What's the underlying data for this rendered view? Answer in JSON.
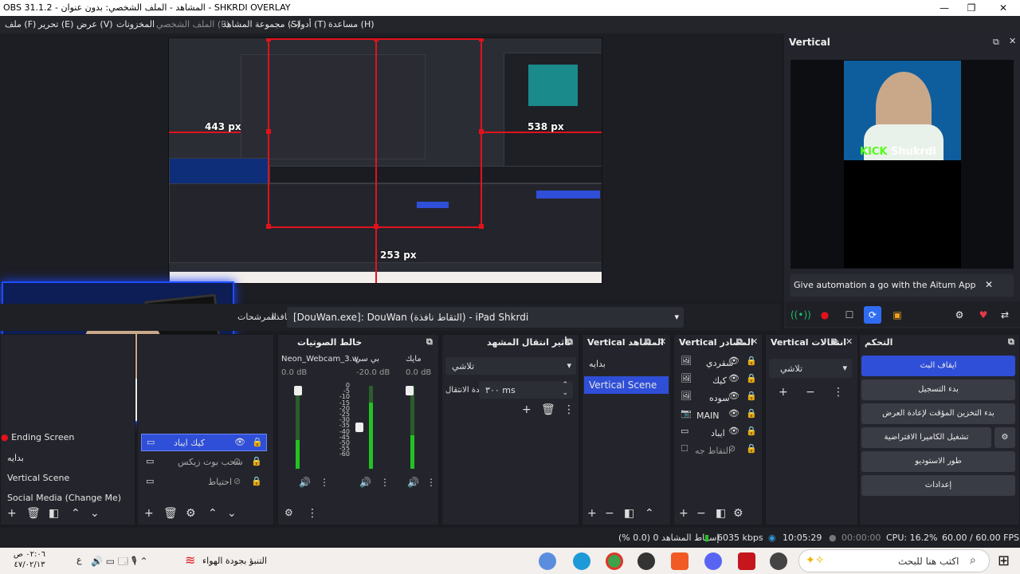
{
  "window": {
    "title": "OBS 31.1.2 - المشاهد - الملف الشخصي: بدون عنوان - SHKRDI OVERLAY"
  },
  "menu": [
    {
      "label": "ملف (F)"
    },
    {
      "label": "تحرير (E)"
    },
    {
      "label": "عرض (V)"
    },
    {
      "label": "المخزونات"
    },
    {
      "label": "الملف الشخصي (P)"
    },
    {
      "label": "مجموعة المشاهد (S)"
    },
    {
      "label": "أدوات (T)"
    },
    {
      "label": "مساعدة (H)"
    }
  ],
  "preview": {
    "label_left": "443 px",
    "label_right": "538 px",
    "label_bottom": "253 px"
  },
  "vertical_dock": {
    "title": "Vertical",
    "overlay_brand": "KICK",
    "overlay_name": "Shukrdi",
    "aitum_text": "Give automation a go with the Aitum App"
  },
  "source_toolbar": {
    "window_label": "نافذة",
    "window_value": "[DouWan.exe]: DouWan (التقاط نافذة) - iPad Shkrdi",
    "filters_label": "المرشحات"
  },
  "scenes": {
    "items": [
      "Ending Screen",
      "بدايه",
      "Vertical Scene",
      "Social Media (Change Me)"
    ]
  },
  "sources": {
    "items": [
      "كيك ايباد",
      "سحب بوت زيكس",
      "احتياط"
    ]
  },
  "mixer": {
    "title": "خالط الصوتيات",
    "channels": [
      {
        "name": "Neon_Webcam_3.w",
        "db": "0.0 dB",
        "level": 0.35
      },
      {
        "name": "بي سي",
        "db": "-20.0 dB",
        "level": 0.8
      },
      {
        "name": "مايك",
        "db": "0.0 dB",
        "level": 0.4
      }
    ],
    "scale": [
      "0",
      "-5",
      "-10",
      "-15",
      "-20",
      "-25",
      "-30",
      "-35",
      "-40",
      "-45",
      "-50",
      "-55",
      "-60"
    ]
  },
  "transitions": {
    "title": "تأثير انتقال المشهد",
    "type": "تلاشي",
    "duration_label": "مدة الانتقال",
    "duration_value": "٣٠٠ ms"
  },
  "vert_scenes": {
    "title": "Vertical المشاهد",
    "items": [
      "بدايه",
      "Vertical Scene"
    ]
  },
  "vert_sources": {
    "title": "Vertical المصادر",
    "items": [
      "شقردي",
      "كيك",
      "سوده",
      "MAIN",
      "ايباد",
      "التقاط جه"
    ]
  },
  "vert_transitions": {
    "title": "Vertical انتقالات",
    "type": "تلاشي"
  },
  "controls": {
    "title": "التحكم",
    "buttons": [
      "ايقاف البث",
      "بدء التسجيل",
      "بدء التخزين المؤقت لإعادة العرض",
      "تشغيل الكاميرا الافتراضية",
      "طور الاستوديو",
      "إعدادات"
    ]
  },
  "status": {
    "dropped": "إسقاط المشاهد 0 (0.0 %)",
    "bitrate": "6035 kbps",
    "stream_time": "10:05:29",
    "rec_time": "00:00:00",
    "cpu": "CPU: 16.2%",
    "fps": "60.00 / 60.00 FPS"
  },
  "taskbar": {
    "search_placeholder": "اكتب هنا للبحث",
    "weather": "التنبؤ بجودة الهواء",
    "time": "٠٢:٠٦ ص",
    "date": "٤٧/٠٢/١٣",
    "lang": "ع"
  },
  "colors": {
    "accent": "#2f4fd8",
    "guide": "#e2121b",
    "kick": "#53fc18"
  }
}
